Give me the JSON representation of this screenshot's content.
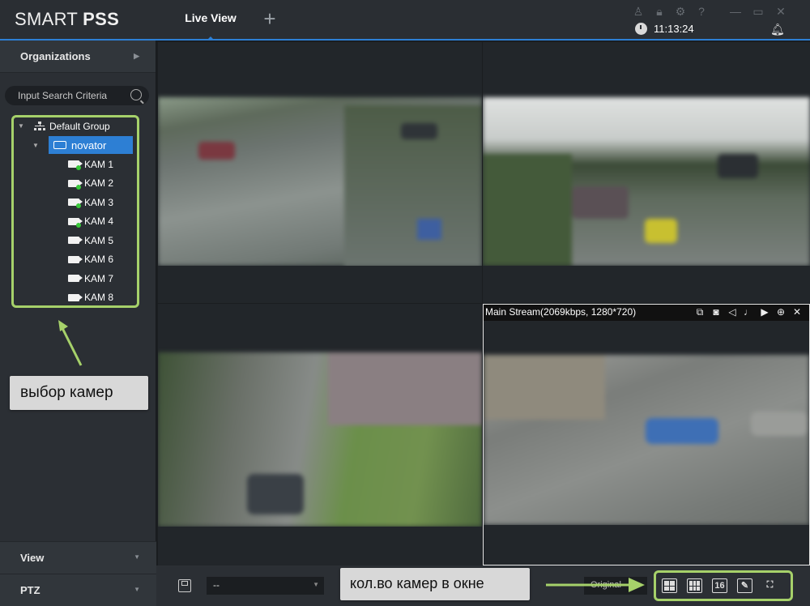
{
  "app": {
    "title_light": "SMART ",
    "title_bold": "PSS"
  },
  "tabs": [
    {
      "label": "Live View"
    }
  ],
  "header": {
    "time": "11:13:24"
  },
  "sidebar": {
    "organizations_label": "Organizations",
    "search_placeholder": "Input Search Criteria",
    "tree": {
      "group": "Default Group",
      "device": "novator",
      "cameras": [
        {
          "label": "KAM 1",
          "online": true
        },
        {
          "label": "KAM 2",
          "online": true
        },
        {
          "label": "KAM 3",
          "online": true
        },
        {
          "label": "KAM 4",
          "online": true
        },
        {
          "label": "KAM 5",
          "online": false
        },
        {
          "label": "KAM 6",
          "online": false
        },
        {
          "label": "KAM 7",
          "online": false
        },
        {
          "label": "KAM 8",
          "online": false
        }
      ]
    },
    "view_label": "View",
    "ptz_label": "PTZ"
  },
  "annotations": {
    "camera_select": "выбор камер",
    "cameras_in_window": "кол.во камер в окне"
  },
  "video": {
    "stream_info": "Main Stream(2069kbps, 1280*720)"
  },
  "bottombar": {
    "view_select_value": "--",
    "aspect_value": "Original",
    "layout_16_label": "16"
  },
  "colors": {
    "accent": "#2d7fd4",
    "highlight": "#a6d16a",
    "online": "#38c83a"
  }
}
